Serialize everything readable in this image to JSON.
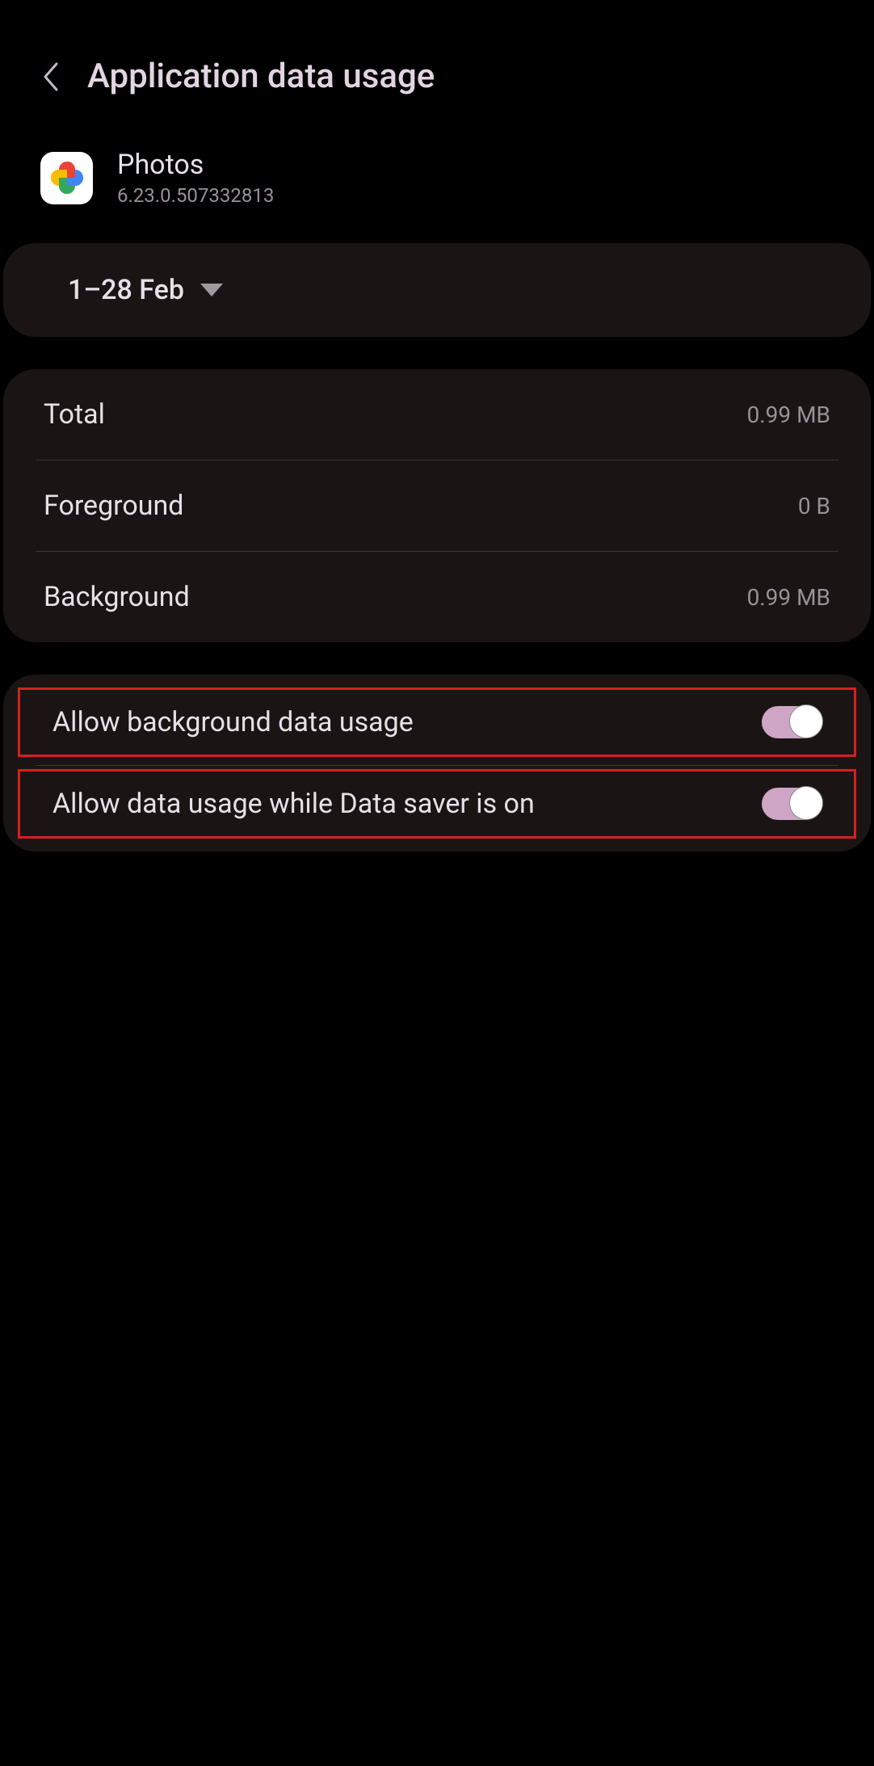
{
  "header": {
    "title": "Application data usage"
  },
  "app": {
    "name": "Photos",
    "version": "6.23.0.507332813"
  },
  "dateRange": {
    "label": "1–28 Feb"
  },
  "usage": {
    "total": {
      "label": "Total",
      "value": "0.99 MB"
    },
    "foreground": {
      "label": "Foreground",
      "value": "0 B"
    },
    "background": {
      "label": "Background",
      "value": "0.99 MB"
    }
  },
  "toggles": {
    "backgroundData": {
      "label": "Allow background data usage",
      "enabled": true
    },
    "dataSaver": {
      "label": "Allow data usage while Data saver is on",
      "enabled": true
    }
  }
}
